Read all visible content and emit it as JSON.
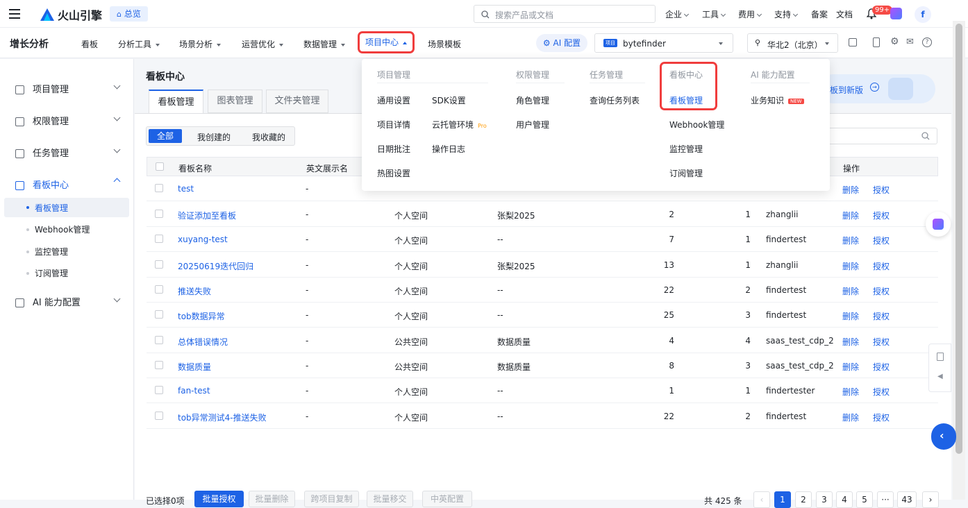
{
  "topbar": {
    "brand": "火山引擎",
    "overview_label": "总览",
    "search_placeholder": "搜索产品或文档",
    "nav": [
      "企业",
      "工具",
      "费用",
      "支持",
      "备案",
      "文档"
    ],
    "notify_badge": "99+",
    "avatar_letter": "f"
  },
  "menubar": {
    "product": "增长分析",
    "items": [
      "看板",
      "分析工具",
      "场景分析",
      "运营优化",
      "数据管理",
      "项目中心",
      "场景模板"
    ],
    "ai_label": "AI 配置",
    "project_tag": "项目",
    "project_name": "bytefinder",
    "region": "华北2（北京）"
  },
  "sidebar": {
    "groups": [
      "项目管理",
      "权限管理",
      "任务管理",
      "看板中心",
      "AI 能力配置"
    ],
    "subitems": [
      "看板管理",
      "Webhook管理",
      "监控管理",
      "订阅管理"
    ]
  },
  "page": {
    "title": "看板中心",
    "tabs": [
      "看板管理",
      "图表管理",
      "文件夹管理"
    ],
    "filters": [
      "全部",
      "我创建的",
      "我收藏的"
    ],
    "new_version": "板到新版"
  },
  "table": {
    "headers": [
      "看板名称",
      "英文展示名",
      "操作"
    ],
    "action_delete": "删除",
    "action_auth": "授权",
    "rows": [
      {
        "name": "test",
        "en": "-",
        "space": "",
        "folder": "",
        "charts": "",
        "members": "",
        "owner": ""
      },
      {
        "name": "验证添加至看板",
        "en": "-",
        "space": "个人空间",
        "folder": "张梨2025",
        "charts": "2",
        "members": "1",
        "owner": "zhanglii"
      },
      {
        "name": "xuyang-test",
        "en": "-",
        "space": "个人空间",
        "folder": "--",
        "charts": "7",
        "members": "1",
        "owner": "findertest"
      },
      {
        "name": "20250619迭代回归",
        "en": "-",
        "space": "个人空间",
        "folder": "张梨2025",
        "charts": "13",
        "members": "1",
        "owner": "zhanglii"
      },
      {
        "name": "推送失败",
        "en": "-",
        "space": "个人空间",
        "folder": "--",
        "charts": "22",
        "members": "2",
        "owner": "findertest"
      },
      {
        "name": "tob数据异常",
        "en": "-",
        "space": "个人空间",
        "folder": "--",
        "charts": "25",
        "members": "3",
        "owner": "findertest"
      },
      {
        "name": "总体错误情况",
        "en": "-",
        "space": "公共空间",
        "folder": "数据质量",
        "charts": "4",
        "members": "4",
        "owner": "saas_test_cdp_2"
      },
      {
        "name": "数据质量",
        "en": "-",
        "space": "公共空间",
        "folder": "数据质量",
        "charts": "8",
        "members": "3",
        "owner": "saas_test_cdp_2"
      },
      {
        "name": "fan-test",
        "en": "-",
        "space": "个人空间",
        "folder": "--",
        "charts": "1",
        "members": "1",
        "owner": "findertester"
      },
      {
        "name": "tob异常测试4-推送失败",
        "en": "-",
        "space": "个人空间",
        "folder": "--",
        "charts": "22",
        "members": "2",
        "owner": "findertest"
      }
    ]
  },
  "footer": {
    "selected": "已选择0项",
    "batch_auth": "批量授权",
    "batch_delete": "批量删除",
    "cross_copy": "跨项目复制",
    "batch_move": "批量移交",
    "lang_config": "中英配置",
    "total": "共 425 条",
    "pages": [
      "1",
      "2",
      "3",
      "4",
      "5",
      "···",
      "43"
    ]
  },
  "dropdown": {
    "col1_title": "项目管理",
    "col1_a": [
      "通用设置",
      "项目详情",
      "日期批注",
      "热图设置"
    ],
    "col1_b": [
      "SDK设置",
      "云托管环境",
      "操作日志"
    ],
    "pro_badge": "Pro",
    "col2_title": "权限管理",
    "col2": [
      "角色管理",
      "用户管理"
    ],
    "col3_title": "任务管理",
    "col3": [
      "查询任务列表"
    ],
    "col4_title": "看板中心",
    "col4": [
      "看板管理",
      "Webhook管理",
      "监控管理",
      "订阅管理"
    ],
    "col5_title": "AI 能力配置",
    "col5": [
      "业务知识"
    ],
    "new_badge": "NEW"
  },
  "colors": {
    "accent": "#1d62e5",
    "highlight": "#f03d3d"
  }
}
